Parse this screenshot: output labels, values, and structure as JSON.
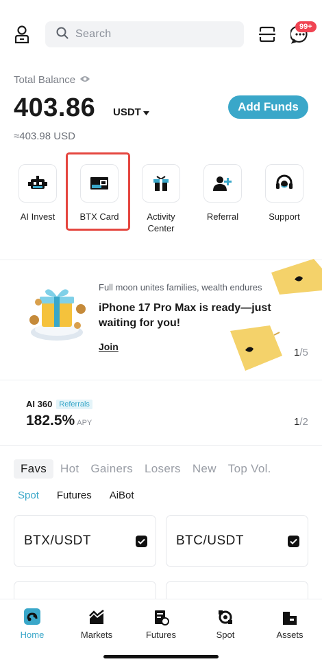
{
  "header": {
    "search_placeholder": "Search",
    "badge": "99+"
  },
  "balance": {
    "label": "Total Balance",
    "value": "403.86",
    "unit": "USDT",
    "approx": "≈403.98 USD",
    "add_funds": "Add Funds"
  },
  "shortcuts": [
    {
      "label": "AI Invest",
      "icon": "robot-icon"
    },
    {
      "label": "BTX Card",
      "icon": "card-icon"
    },
    {
      "label": "Activity Center",
      "icon": "gift-box-icon"
    },
    {
      "label": "Referral",
      "icon": "add-user-icon"
    },
    {
      "label": "Support",
      "icon": "headset-icon"
    }
  ],
  "promo": {
    "subtitle": "Full moon unites families, wealth endures",
    "title": "iPhone 17 Pro Max is ready—just waiting for you!",
    "cta": "Join",
    "page_current": "1",
    "page_total": "/5"
  },
  "ai360": {
    "label": "AI 360",
    "tag": "Referrals",
    "apy": "182.5%",
    "apy_suffix": "APY",
    "page_current": "1",
    "page_total": "/2"
  },
  "market_tabs": [
    "Favs",
    "Hot",
    "Gainers",
    "Losers",
    "New",
    "Top Vol."
  ],
  "sub_tabs": [
    "Spot",
    "Futures",
    "AiBot"
  ],
  "favorites": [
    "BTX/USDT",
    "BTC/USDT"
  ],
  "bottom_nav": [
    "Home",
    "Markets",
    "Futures",
    "Spot",
    "Assets"
  ],
  "colors": {
    "accent": "#3aa7c9",
    "badge": "#f04452",
    "highlight": "#e5463f"
  }
}
